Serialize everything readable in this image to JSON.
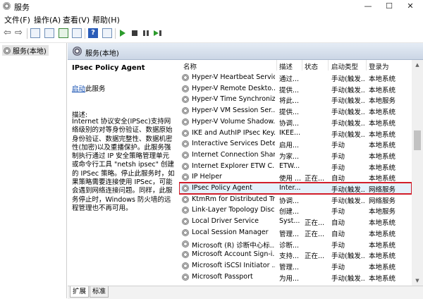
{
  "window": {
    "title": "服务",
    "min_glyph": "—",
    "max_glyph": "☐",
    "close_glyph": "✕"
  },
  "menu": [
    "文件(F)",
    "操作(A)",
    "查看(V)",
    "帮助(H)"
  ],
  "toolbar": {
    "help_glyph": "?",
    "back_glyph": "⇦",
    "forward_glyph": "⇨"
  },
  "tree": {
    "root_label": "服务(本地)"
  },
  "header": {
    "title": "服务(本地)"
  },
  "details": {
    "service_name": "IPsec Policy Agent",
    "start_link_word": "启动",
    "start_link_suffix": "此服务",
    "description_label": "描述:",
    "description": "Internet 协议安全(IPSec)支持网络级别的对等身份验证、数据原始身份验证、数据完整性、数据机密性(加密)以及重播保护。此服务强制执行通过 IP 安全策略管理单元或命令行工具 \"netsh ipsec\" 创建的 IPSec 策略。停止此服务时，如果策略需要连接使用 IPSec，可能会遇到网络连接问题。同样，此服务停止时，Windows 防火墙的远程管理也不再可用。"
  },
  "columns": {
    "name": "名称",
    "desc": "描述",
    "state": "状态",
    "startup": "启动类型",
    "logon": "登录为",
    "sort_caret": "^"
  },
  "services": [
    {
      "name": "Hyper-V Heartbeat Service",
      "desc": "通过...",
      "state": "",
      "startup": "手动(触发...",
      "logon": "本地系统"
    },
    {
      "name": "Hyper-V Remote Deskto...",
      "desc": "提供...",
      "state": "",
      "startup": "手动(触发...",
      "logon": "本地系统"
    },
    {
      "name": "Hyper-V Time Synchroniz...",
      "desc": "将此...",
      "state": "",
      "startup": "手动(触发...",
      "logon": "本地服务"
    },
    {
      "name": "Hyper-V VM Session Ser...",
      "desc": "提供...",
      "state": "",
      "startup": "手动(触发...",
      "logon": "本地系统"
    },
    {
      "name": "Hyper-V Volume Shadow...",
      "desc": "协调...",
      "state": "",
      "startup": "手动(触发...",
      "logon": "本地系统"
    },
    {
      "name": "IKE and AuthIP IPsec Key...",
      "desc": "IKEE...",
      "state": "",
      "startup": "手动(触发...",
      "logon": "本地系统"
    },
    {
      "name": "Interactive Services Dete...",
      "desc": "启用...",
      "state": "",
      "startup": "手动",
      "logon": "本地系统"
    },
    {
      "name": "Internet Connection Shari...",
      "desc": "为家...",
      "state": "",
      "startup": "手动",
      "logon": "本地系统"
    },
    {
      "name": "Internet Explorer ETW C...",
      "desc": "ETW...",
      "state": "",
      "startup": "手动",
      "logon": "本地系统"
    },
    {
      "name": "IP Helper",
      "desc": "使用 ...",
      "state": "正在...",
      "startup": "自动",
      "logon": "本地系统"
    },
    {
      "name": "IPsec Policy Agent",
      "desc": "Inter...",
      "state": "",
      "startup": "手动(触发...",
      "logon": "网络服务",
      "selected": true
    },
    {
      "name": "KtmRm for Distributed Tr...",
      "desc": "协调...",
      "state": "",
      "startup": "手动(触发...",
      "logon": "网络服务"
    },
    {
      "name": "Link-Layer Topology Disc...",
      "desc": "创建...",
      "state": "",
      "startup": "手动",
      "logon": "本地服务"
    },
    {
      "name": "Local Driver Service",
      "desc": "Syst...",
      "state": "正在...",
      "startup": "自动",
      "logon": "本地系统"
    },
    {
      "name": "Local Session Manager",
      "desc": "管理...",
      "state": "正在...",
      "startup": "自动",
      "logon": "本地系统"
    },
    {
      "name": "Microsoft (R) 诊断中心标...",
      "desc": "诊断...",
      "state": "",
      "startup": "手动",
      "logon": "本地系统"
    },
    {
      "name": "Microsoft Account Sign-i...",
      "desc": "支持...",
      "state": "正在...",
      "startup": "手动(触发...",
      "logon": "本地系统"
    },
    {
      "name": "Microsoft iSCSI Initiator ...",
      "desc": "管理...",
      "state": "",
      "startup": "手动",
      "logon": "本地系统"
    },
    {
      "name": "Microsoft Passport",
      "desc": "为用...",
      "state": "",
      "startup": "手动(触发...",
      "logon": "本地系统"
    }
  ],
  "tabs": [
    "扩展",
    "标准"
  ],
  "colors": {
    "header_from": "#e5ecf5",
    "header_to": "#cbd6e5",
    "selection_outline": "#d21e2a",
    "link": "#0645ad"
  }
}
